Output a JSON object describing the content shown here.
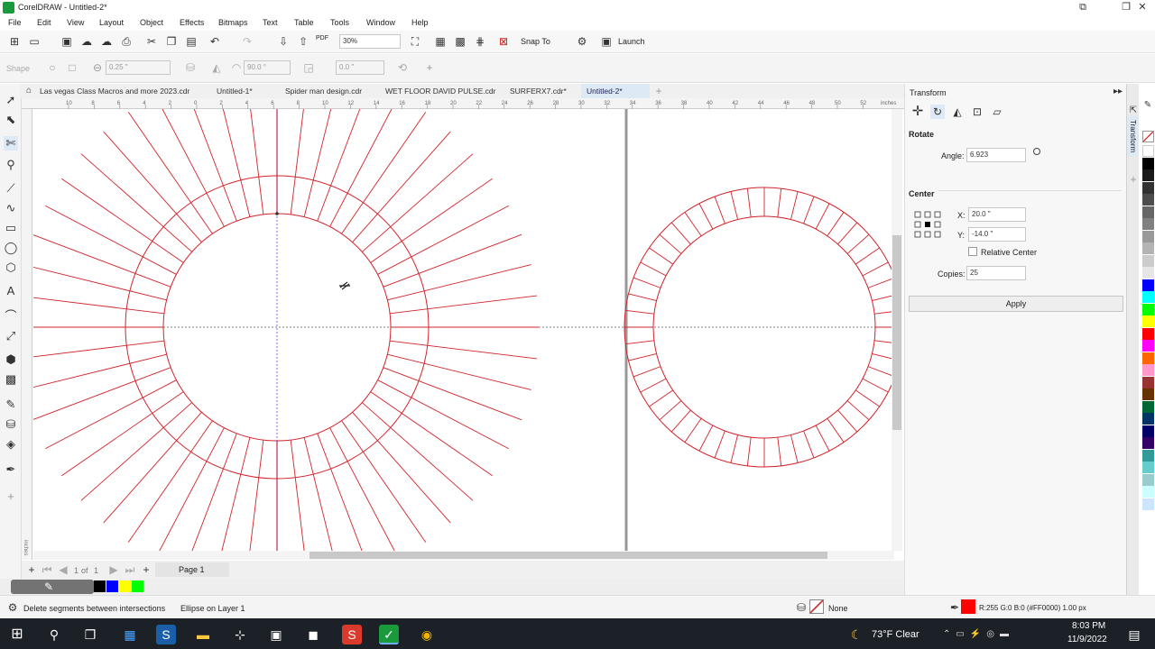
{
  "window": {
    "title": "CorelDRAW - Untitled-2*"
  },
  "menu": [
    "File",
    "Edit",
    "View",
    "Layout",
    "Object",
    "Effects",
    "Bitmaps",
    "Text",
    "Table",
    "Tools",
    "Window",
    "Help"
  ],
  "toolbar": {
    "zoom": "30%",
    "snap_to": "Snap To",
    "launch": "Launch",
    "pdf": "PDF"
  },
  "propertybar": {
    "shape_label": "Shape",
    "outline_width": "0.25 \"",
    "angle": "90.0 °",
    "offset": "0.0 \""
  },
  "tabs": [
    "Las vegas Class Macros and more 2023.cdr",
    "Untitled-1*",
    "Spider man design.cdr",
    "WET FLOOR DAVID PULSE.cdr",
    "SURFERX7.cdr*",
    "Untitled-2*"
  ],
  "ruler": {
    "unit": "inches",
    "ticks": [
      "10",
      "8",
      "6",
      "4",
      "2",
      "0",
      "2",
      "4",
      "6",
      "8",
      "10",
      "12",
      "14",
      "16",
      "18",
      "20",
      "22",
      "24",
      "26",
      "28",
      "30",
      "32",
      "34",
      "36",
      "38",
      "40",
      "42",
      "44",
      "46",
      "48",
      "50",
      "52",
      "54"
    ],
    "side_label": "inches"
  },
  "pagenav": {
    "page_of": "1",
    "of_label": "of",
    "total": "1",
    "page_tab": "Page 1"
  },
  "status": {
    "hint": "Delete segments between intersections",
    "object": "Ellipse on Layer 1",
    "fill": "None",
    "outline": "R:255 G:0 B:0 (#FF0000)  1.00 px"
  },
  "docker": {
    "title": "Transform",
    "rotate_heading": "Rotate",
    "angle_label": "Angle:",
    "angle_value": "6.923",
    "center_heading": "Center",
    "x_label": "X:",
    "x_value": "20.0 \"",
    "y_label": "Y:",
    "y_value": "-14.0 \"",
    "relative_center": "Relative Center",
    "copies_label": "Copies:",
    "copies_value": "25",
    "apply": "Apply",
    "side_tab": "Transform"
  },
  "taskbar": {
    "weather": "73°F  Clear",
    "time": "8:03 PM",
    "date": "11/9/2022"
  },
  "colors": {
    "accent": "#1a9a3c",
    "stroke": "#d2232a",
    "guide_vertical": "#8a2be2",
    "palette_right": [
      "#ffffff",
      "#000000",
      "#1a1a1a",
      "#333333",
      "#4d4d4d",
      "#666666",
      "#808080",
      "#999999",
      "#b3b3b3",
      "#cccccc",
      "#e6e6e6",
      "#0000ff",
      "#00ffff",
      "#00ff00",
      "#ffff00",
      "#ff0000",
      "#ff00ff",
      "#ff6600",
      "#ff99cc",
      "#993333",
      "#663300",
      "#006633",
      "#003366",
      "#000066",
      "#330066",
      "#339999",
      "#66cccc",
      "#99cccc",
      "#ccffff",
      "#cce6ff"
    ],
    "palette_bottom": [
      "#000000",
      "#0000ff",
      "#ffff00",
      "#00ff00"
    ],
    "outline_swatch": "#ff0000"
  }
}
